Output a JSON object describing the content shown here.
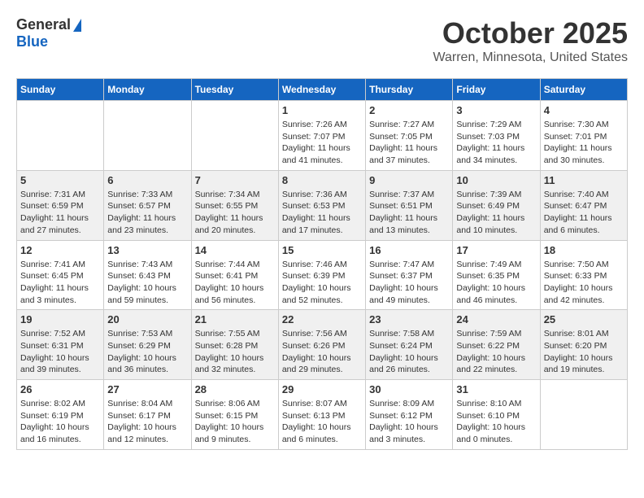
{
  "header": {
    "logo_general": "General",
    "logo_blue": "Blue",
    "month": "October 2025",
    "location": "Warren, Minnesota, United States"
  },
  "weekdays": [
    "Sunday",
    "Monday",
    "Tuesday",
    "Wednesday",
    "Thursday",
    "Friday",
    "Saturday"
  ],
  "weeks": [
    [
      {
        "day": "",
        "info": ""
      },
      {
        "day": "",
        "info": ""
      },
      {
        "day": "",
        "info": ""
      },
      {
        "day": "1",
        "sunrise": "7:26 AM",
        "sunset": "7:07 PM",
        "daylight": "11 hours and 41 minutes."
      },
      {
        "day": "2",
        "sunrise": "7:27 AM",
        "sunset": "7:05 PM",
        "daylight": "11 hours and 37 minutes."
      },
      {
        "day": "3",
        "sunrise": "7:29 AM",
        "sunset": "7:03 PM",
        "daylight": "11 hours and 34 minutes."
      },
      {
        "day": "4",
        "sunrise": "7:30 AM",
        "sunset": "7:01 PM",
        "daylight": "11 hours and 30 minutes."
      }
    ],
    [
      {
        "day": "5",
        "sunrise": "7:31 AM",
        "sunset": "6:59 PM",
        "daylight": "11 hours and 27 minutes."
      },
      {
        "day": "6",
        "sunrise": "7:33 AM",
        "sunset": "6:57 PM",
        "daylight": "11 hours and 23 minutes."
      },
      {
        "day": "7",
        "sunrise": "7:34 AM",
        "sunset": "6:55 PM",
        "daylight": "11 hours and 20 minutes."
      },
      {
        "day": "8",
        "sunrise": "7:36 AM",
        "sunset": "6:53 PM",
        "daylight": "11 hours and 17 minutes."
      },
      {
        "day": "9",
        "sunrise": "7:37 AM",
        "sunset": "6:51 PM",
        "daylight": "11 hours and 13 minutes."
      },
      {
        "day": "10",
        "sunrise": "7:39 AM",
        "sunset": "6:49 PM",
        "daylight": "11 hours and 10 minutes."
      },
      {
        "day": "11",
        "sunrise": "7:40 AM",
        "sunset": "6:47 PM",
        "daylight": "11 hours and 6 minutes."
      }
    ],
    [
      {
        "day": "12",
        "sunrise": "7:41 AM",
        "sunset": "6:45 PM",
        "daylight": "11 hours and 3 minutes."
      },
      {
        "day": "13",
        "sunrise": "7:43 AM",
        "sunset": "6:43 PM",
        "daylight": "10 hours and 59 minutes."
      },
      {
        "day": "14",
        "sunrise": "7:44 AM",
        "sunset": "6:41 PM",
        "daylight": "10 hours and 56 minutes."
      },
      {
        "day": "15",
        "sunrise": "7:46 AM",
        "sunset": "6:39 PM",
        "daylight": "10 hours and 52 minutes."
      },
      {
        "day": "16",
        "sunrise": "7:47 AM",
        "sunset": "6:37 PM",
        "daylight": "10 hours and 49 minutes."
      },
      {
        "day": "17",
        "sunrise": "7:49 AM",
        "sunset": "6:35 PM",
        "daylight": "10 hours and 46 minutes."
      },
      {
        "day": "18",
        "sunrise": "7:50 AM",
        "sunset": "6:33 PM",
        "daylight": "10 hours and 42 minutes."
      }
    ],
    [
      {
        "day": "19",
        "sunrise": "7:52 AM",
        "sunset": "6:31 PM",
        "daylight": "10 hours and 39 minutes."
      },
      {
        "day": "20",
        "sunrise": "7:53 AM",
        "sunset": "6:29 PM",
        "daylight": "10 hours and 36 minutes."
      },
      {
        "day": "21",
        "sunrise": "7:55 AM",
        "sunset": "6:28 PM",
        "daylight": "10 hours and 32 minutes."
      },
      {
        "day": "22",
        "sunrise": "7:56 AM",
        "sunset": "6:26 PM",
        "daylight": "10 hours and 29 minutes."
      },
      {
        "day": "23",
        "sunrise": "7:58 AM",
        "sunset": "6:24 PM",
        "daylight": "10 hours and 26 minutes."
      },
      {
        "day": "24",
        "sunrise": "7:59 AM",
        "sunset": "6:22 PM",
        "daylight": "10 hours and 22 minutes."
      },
      {
        "day": "25",
        "sunrise": "8:01 AM",
        "sunset": "6:20 PM",
        "daylight": "10 hours and 19 minutes."
      }
    ],
    [
      {
        "day": "26",
        "sunrise": "8:02 AM",
        "sunset": "6:19 PM",
        "daylight": "10 hours and 16 minutes."
      },
      {
        "day": "27",
        "sunrise": "8:04 AM",
        "sunset": "6:17 PM",
        "daylight": "10 hours and 12 minutes."
      },
      {
        "day": "28",
        "sunrise": "8:06 AM",
        "sunset": "6:15 PM",
        "daylight": "10 hours and 9 minutes."
      },
      {
        "day": "29",
        "sunrise": "8:07 AM",
        "sunset": "6:13 PM",
        "daylight": "10 hours and 6 minutes."
      },
      {
        "day": "30",
        "sunrise": "8:09 AM",
        "sunset": "6:12 PM",
        "daylight": "10 hours and 3 minutes."
      },
      {
        "day": "31",
        "sunrise": "8:10 AM",
        "sunset": "6:10 PM",
        "daylight": "10 hours and 0 minutes."
      },
      {
        "day": "",
        "info": ""
      }
    ]
  ],
  "labels": {
    "sunrise_prefix": "Sunrise: ",
    "sunset_prefix": "Sunset: ",
    "daylight_label": "Daylight: "
  }
}
